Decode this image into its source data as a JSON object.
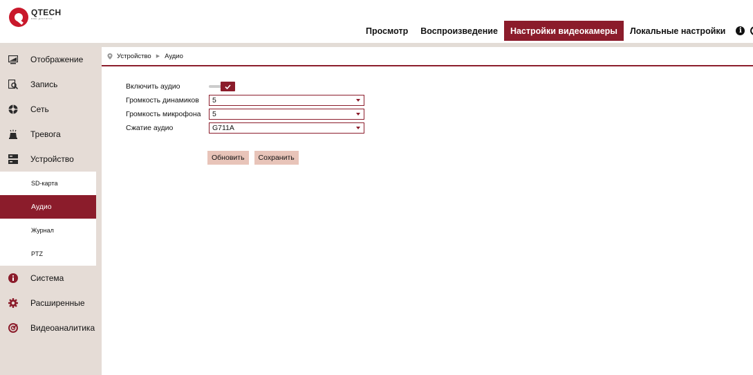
{
  "header": {
    "brand": "QTECH",
    "slogan": "ваш достаток",
    "nav": [
      {
        "label": "Просмотр",
        "active": false
      },
      {
        "label": "Воспроизведение",
        "active": false
      },
      {
        "label": "Настройки видеокамеры",
        "active": true
      },
      {
        "label": "Локальные настройки",
        "active": false
      }
    ]
  },
  "sidebar": {
    "items": [
      {
        "label": "Отображение",
        "icon": "monitor-icon"
      },
      {
        "label": "Запись",
        "icon": "record-icon"
      },
      {
        "label": "Сеть",
        "icon": "network-icon"
      },
      {
        "label": "Тревога",
        "icon": "alarm-icon"
      },
      {
        "label": "Устройство",
        "icon": "device-icon"
      }
    ],
    "subitems": [
      {
        "label": "SD-карта",
        "active": false
      },
      {
        "label": "Аудио",
        "active": true
      },
      {
        "label": "Журнал",
        "active": false
      },
      {
        "label": "PTZ",
        "active": false
      }
    ],
    "items_after": [
      {
        "label": "Система",
        "icon": "info-circle-icon"
      },
      {
        "label": "Расширенные",
        "icon": "gear-icon"
      },
      {
        "label": "Видеоаналитика",
        "icon": "analytics-icon"
      }
    ]
  },
  "breadcrumb": {
    "parent": "Устройство",
    "current": "Аудио"
  },
  "form": {
    "enable_audio_label": "Включить аудио",
    "enable_audio_value": true,
    "speaker_volume_label": "Громкость динамиков",
    "speaker_volume_value": "5",
    "mic_volume_label": "Громкость микрофона",
    "mic_volume_value": "5",
    "compression_label": "Сжатие аудио",
    "compression_value": "G711A"
  },
  "buttons": {
    "refresh": "Обновить",
    "save": "Сохранить"
  },
  "colors": {
    "accent": "#8b1c2b",
    "sidebar_bg": "#e5dcd6",
    "button_bg": "#e8c4b9"
  }
}
